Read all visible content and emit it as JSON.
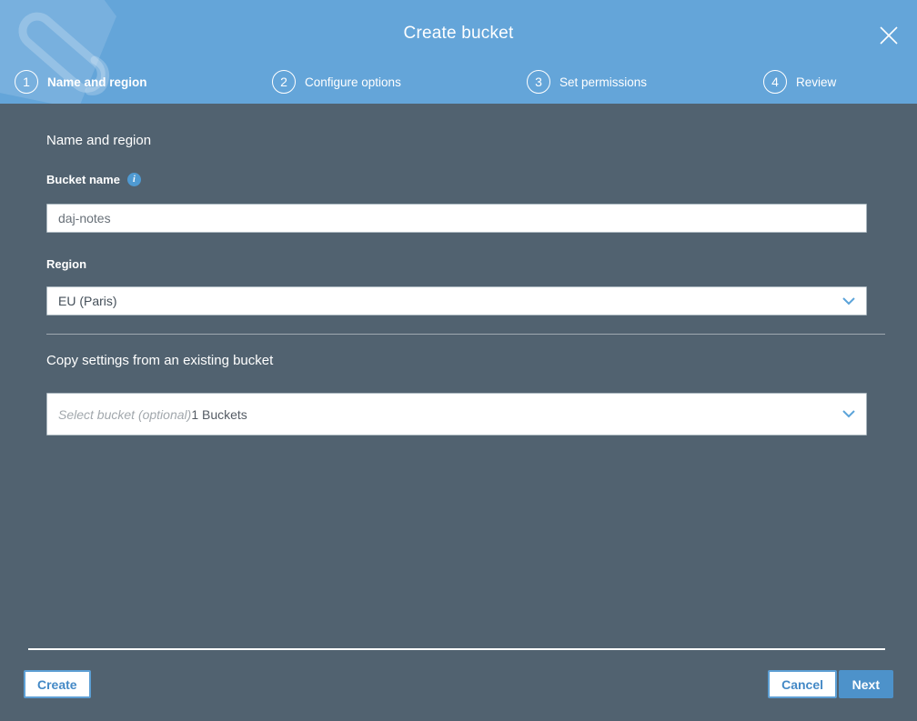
{
  "header": {
    "title": "Create bucket",
    "steps": [
      {
        "number": "1",
        "label": "Name and region",
        "active": true
      },
      {
        "number": "2",
        "label": "Configure options",
        "active": false
      },
      {
        "number": "3",
        "label": "Set permissions",
        "active": false
      },
      {
        "number": "4",
        "label": "Review",
        "active": false
      }
    ]
  },
  "form": {
    "section_title": "Name and region",
    "bucket_name": {
      "label": "Bucket name",
      "value": "daj-notes"
    },
    "region": {
      "label": "Region",
      "value": "EU (Paris)"
    },
    "copy_settings": {
      "title": "Copy settings from an existing bucket",
      "placeholder": "Select bucket (optional)",
      "count": "1 Buckets"
    }
  },
  "footer": {
    "create_label": "Create",
    "cancel_label": "Cancel",
    "next_label": "Next"
  },
  "icons": {
    "close_icon": "thin-x",
    "chevron_down_icon": "chevron-down",
    "info_icon": "circled-i",
    "bucket_watermark_icon": "s3-bucket",
    "info_glyph": "i"
  },
  "colors": {
    "header_blue": "#64a5d9",
    "body_slate": "#516270",
    "accent_blue": "#4d92ca",
    "white": "#ffffff"
  }
}
